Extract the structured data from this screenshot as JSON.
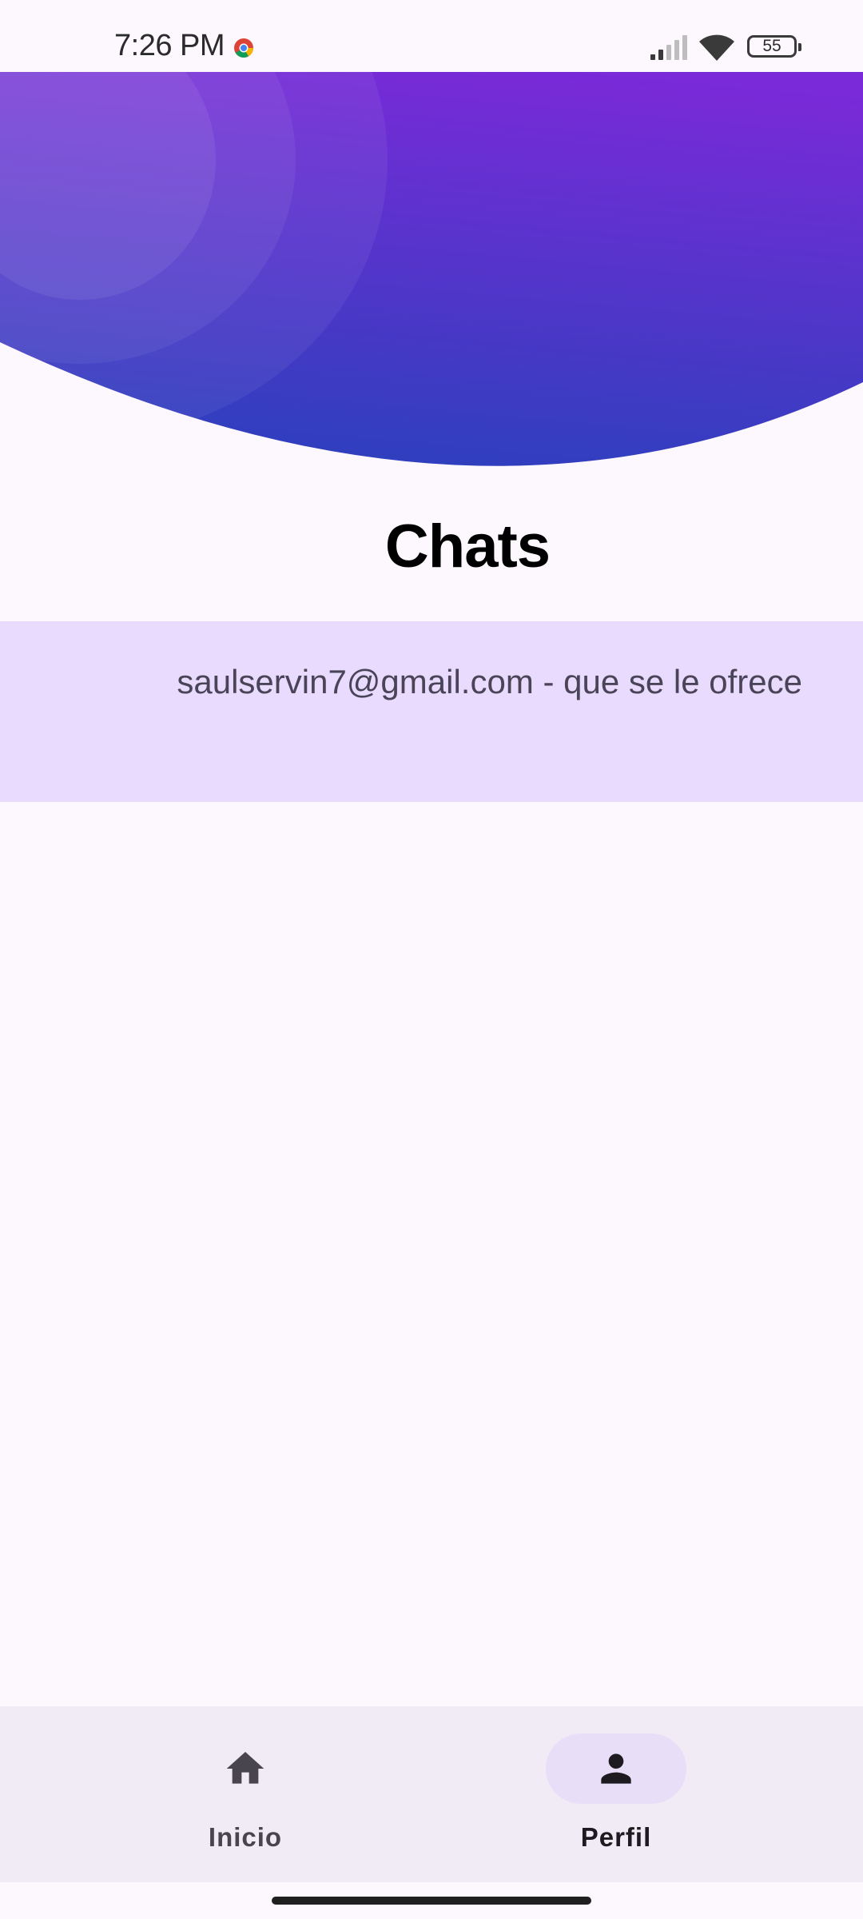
{
  "status_bar": {
    "time": "7:26 PM",
    "battery": "55",
    "icons": [
      "chrome-icon",
      "signal-icon",
      "wifi-icon",
      "battery-icon"
    ]
  },
  "colors": {
    "header_gradient_start": "#8a3bd8",
    "header_gradient_end": "#2e3fbf",
    "chat_item_bg": "#e8dbfd",
    "nav_bg": "#f1ebf5",
    "nav_active_pill": "#e8def8"
  },
  "page": {
    "title": "Chats"
  },
  "chats": [
    {
      "text": "saulservin7@gmail.com - que se le ofrece"
    }
  ],
  "bottom_nav": {
    "items": [
      {
        "label": "Inicio",
        "icon": "home-icon",
        "active": false
      },
      {
        "label": "Perfil",
        "icon": "person-icon",
        "active": true
      }
    ]
  }
}
